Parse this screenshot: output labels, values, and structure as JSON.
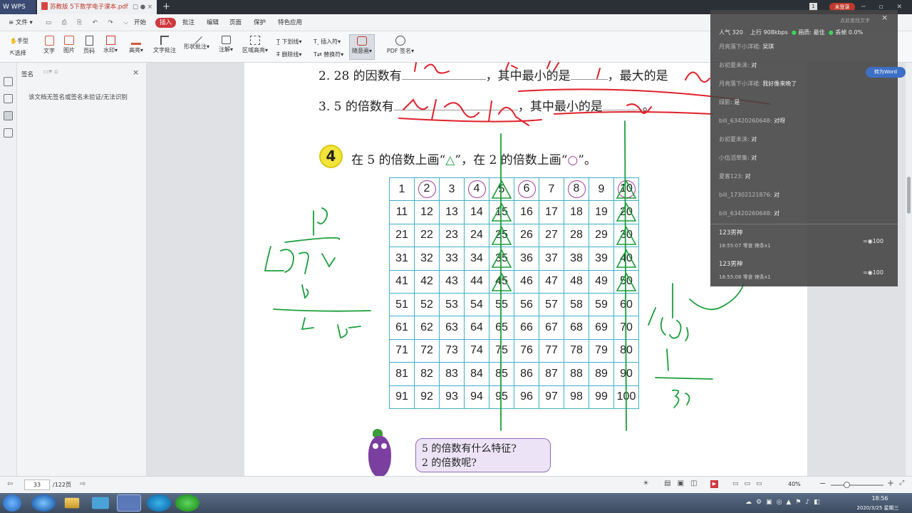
{
  "titlebar": {
    "app_name": "WPS",
    "tab_title": "苏教版 5下数学电子课本.pdf",
    "login_label": "未登录",
    "tab_count": "1"
  },
  "menu": {
    "file": "文件",
    "items": [
      "开始",
      "插入",
      "批注",
      "编辑",
      "页面",
      "保护",
      "特色应用"
    ]
  },
  "ribbon": {
    "hand": "手型",
    "select": "选择",
    "text": "文字",
    "image": "图片",
    "page_num": "页码",
    "watermark": "水印",
    "highlight": "高亮",
    "text_comment": "文字批注",
    "shape_comment": "形状批注",
    "annotate": "注解",
    "area_highlight": "区域高亮",
    "underline": "下划线",
    "strikeout": "删除线",
    "insert_char": "插入符",
    "replace_char": "替换符",
    "freehand": "随意画",
    "pdf_sign": "PDF 签名"
  },
  "signpanel": {
    "title": "签名",
    "message": "该文档无签名或签名未验证/无法识别"
  },
  "document": {
    "q2_text": "2. 28 的因数有",
    "q2_mid": "，其中最小的是",
    "q2_end": "，最大的是",
    "q3_text": "3. 5 的倍数有",
    "q3_mid": "，其中最小的是",
    "q3_end": "。",
    "badge": "4",
    "q4_part1": "在 5 的倍数上画“",
    "q4_tri": "△",
    "q4_part2": "”，在 2 的倍数上画“",
    "q4_circ": "○",
    "q4_part3": "”。",
    "grid_numbers": [
      [
        "1",
        "2",
        "3",
        "4",
        "5",
        "6",
        "7",
        "8",
        "9",
        "10"
      ],
      [
        "11",
        "12",
        "13",
        "14",
        "15",
        "16",
        "17",
        "18",
        "19",
        "20"
      ],
      [
        "21",
        "22",
        "23",
        "24",
        "25",
        "26",
        "27",
        "28",
        "29",
        "30"
      ],
      [
        "31",
        "32",
        "33",
        "34",
        "35",
        "36",
        "37",
        "38",
        "39",
        "40"
      ],
      [
        "41",
        "42",
        "43",
        "44",
        "45",
        "46",
        "47",
        "48",
        "49",
        "50"
      ],
      [
        "51",
        "52",
        "53",
        "54",
        "55",
        "56",
        "57",
        "58",
        "59",
        "60"
      ],
      [
        "61",
        "62",
        "63",
        "64",
        "65",
        "66",
        "67",
        "68",
        "69",
        "70"
      ],
      [
        "71",
        "72",
        "73",
        "74",
        "75",
        "76",
        "77",
        "78",
        "79",
        "80"
      ],
      [
        "81",
        "82",
        "83",
        "84",
        "85",
        "86",
        "87",
        "88",
        "89",
        "90"
      ],
      [
        "91",
        "92",
        "93",
        "94",
        "95",
        "96",
        "97",
        "98",
        "99",
        "100"
      ]
    ],
    "speech_line1": "5 的倍数有什么特征?",
    "speech_line2": "2 的倍数呢?"
  },
  "chat": {
    "popularity_label": "人气",
    "popularity": "320",
    "upload_label": "上行",
    "upload": "908kbps",
    "quality_label": "画质: 最佳",
    "loss_label": "丢帧 0.0%",
    "search_placeholder": "点此查找文字",
    "to_word": "转为Word",
    "messages": [
      {
        "user": "月亮落下小洋裙:",
        "text": "吴琪"
      },
      {
        "user": "お初夏未沫:",
        "text": "对"
      },
      {
        "user": "月亮落下小洋裙:",
        "text": "我好像来晚了"
      },
      {
        "user": "绿影:",
        "text": "是"
      },
      {
        "user": "bili_63420260648:",
        "text": "对呀"
      },
      {
        "user": "お初夏未沫:",
        "text": "对"
      },
      {
        "user": "小伍滔草集:",
        "text": "对"
      },
      {
        "user": "夏客123:",
        "text": "对"
      },
      {
        "user": "bili_17302121876:",
        "text": "对"
      },
      {
        "user": "bili_63420260648:",
        "text": "对"
      }
    ],
    "gifts": [
      {
        "user": "123男神",
        "time": "18:55:07",
        "item": "零食",
        "count": "辣条x1",
        "value": "100"
      },
      {
        "user": "123男神",
        "time": "18:55:08",
        "item": "零食",
        "count": "辣条x1",
        "value": "100"
      }
    ]
  },
  "statusbar": {
    "page_current": "33",
    "page_total": "/122页",
    "zoom": "40%"
  },
  "taskbar": {
    "time": "18:56",
    "date": "2020/3/25 星期三"
  }
}
